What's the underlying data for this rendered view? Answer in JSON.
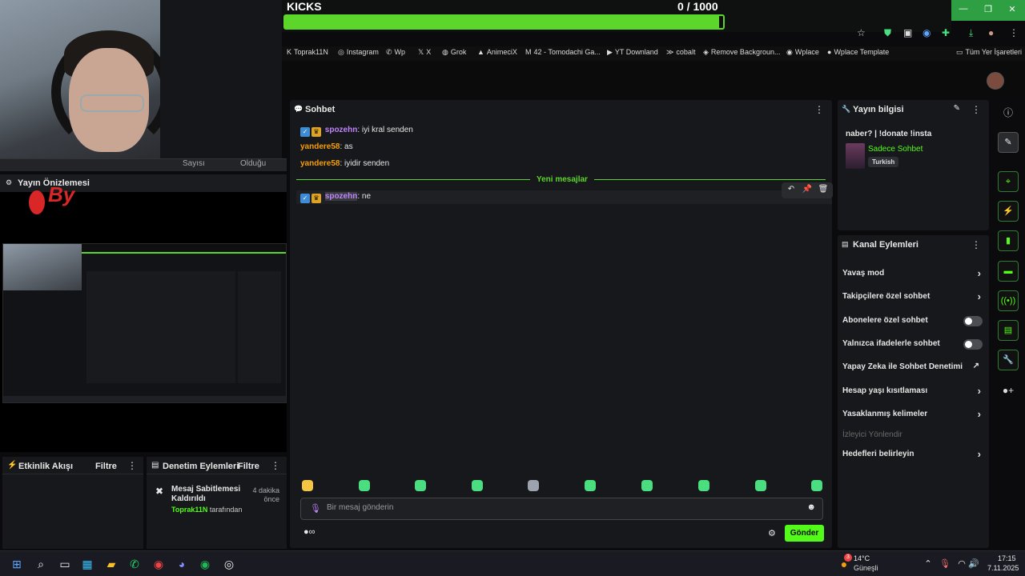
{
  "overlay": {
    "kicks_label": "KICKS",
    "kicks_count": "0  / 1000",
    "goal_progress": 0.99
  },
  "obs": {
    "strip_left": "Sayısı",
    "strip_right": "Olduğu",
    "preview_title": "Yayın Önizlemesi",
    "red_text": "By",
    "activity_title": "Etkinlik Akışı",
    "activity_filter": "Filtre",
    "moderation_title": "Denetim Eylemleri",
    "moderation_filter": "Filtre",
    "mod_event": {
      "title": "Mesaj Sabitlemesi Kaldırıldı",
      "time": "4 dakika önce",
      "user": "Toprak11N",
      "suffix": "tarafından"
    }
  },
  "bookmarks": [
    {
      "label": "Toprak11N",
      "icon": "K"
    },
    {
      "label": "Instagram",
      "icon": "◎"
    },
    {
      "label": "Wp",
      "icon": "✆"
    },
    {
      "label": "X",
      "icon": "𝕏"
    },
    {
      "label": "Grok",
      "icon": "◍"
    },
    {
      "label": "AnimeciX",
      "icon": "▲"
    },
    {
      "label": "42 - Tomodachi Ga...",
      "icon": "M"
    },
    {
      "label": "YT Downland",
      "icon": "▶"
    },
    {
      "label": "cobalt",
      "icon": "≫"
    },
    {
      "label": "Remove Backgroun...",
      "icon": "◈"
    },
    {
      "label": "Wplace",
      "icon": "◉"
    },
    {
      "label": "Wplace Template",
      "icon": "●"
    },
    {
      "label": "Tüm Yer İşaretleri",
      "icon": "▭"
    }
  ],
  "chat": {
    "title": "Sohbet",
    "messages": [
      {
        "user": "spozehn",
        "text": ": iyi kral senden"
      },
      {
        "user": "yandere58",
        "text": ": as"
      },
      {
        "user": "yandere58",
        "text": ": iyidir senden"
      },
      {
        "user": "spozehn",
        "text": ": ne"
      }
    ],
    "new_messages": "Yeni mesajlar",
    "input_placeholder": "Bir mesaj gönderin",
    "send_label": "Gönder"
  },
  "info": {
    "title": "Yayın bilgisi",
    "stream_title": "naber? | !donate !insta",
    "category": "Sadece Sohbet",
    "language": "Turkish"
  },
  "actions": {
    "title": "Kanal Eylemleri",
    "items": [
      {
        "label": "Yavaş mod",
        "control": "chevron"
      },
      {
        "label": "Takipçilere özel sohbet",
        "control": "chevron"
      },
      {
        "label": "Abonelere özel sohbet",
        "control": "toggle"
      },
      {
        "label": "Yalnızca ifadelerle sohbet",
        "control": "toggle"
      },
      {
        "label": "Yapay Zeka ile Sohbet Denetimi",
        "control": "external"
      },
      {
        "label": "Hesap yaşı kısıtlaması",
        "control": "chevron"
      },
      {
        "label": "Yasaklanmış kelimeler",
        "control": "chevron"
      },
      {
        "label": "İzleyici Yönlendir",
        "control": "disabled"
      },
      {
        "label": "Hedefleri belirleyin",
        "control": "chevron"
      }
    ]
  },
  "taskbar": {
    "weather_temp": "14°C",
    "weather_desc": "Güneşli",
    "weather_badge": "3",
    "time": "17:15",
    "date": "7.11.2025"
  },
  "colors": {
    "accent": "#53fc18",
    "username_purple": "#c084fc",
    "username_orange": "#f59e0b"
  }
}
